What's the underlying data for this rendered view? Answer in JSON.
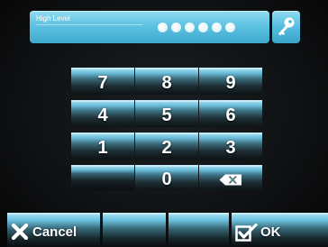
{
  "password_bar": {
    "label": "High Level",
    "masked_digits": 6
  },
  "key_icon": "key-icon",
  "keypad": {
    "rows": [
      [
        "7",
        "8",
        "9"
      ],
      [
        "4",
        "5",
        "6"
      ],
      [
        "1",
        "2",
        "3"
      ],
      [
        "",
        "0",
        "backspace"
      ]
    ],
    "key_7": "7",
    "key_8": "8",
    "key_9": "9",
    "key_4": "4",
    "key_5": "5",
    "key_6": "6",
    "key_1": "1",
    "key_2": "2",
    "key_3": "3",
    "key_0": "0"
  },
  "bottom_bar": {
    "cancel_label": "Cancel",
    "ok_label": "OK"
  },
  "colors": {
    "accent": "#5fc2e2",
    "background": "#101214",
    "text": "#ffffff"
  }
}
